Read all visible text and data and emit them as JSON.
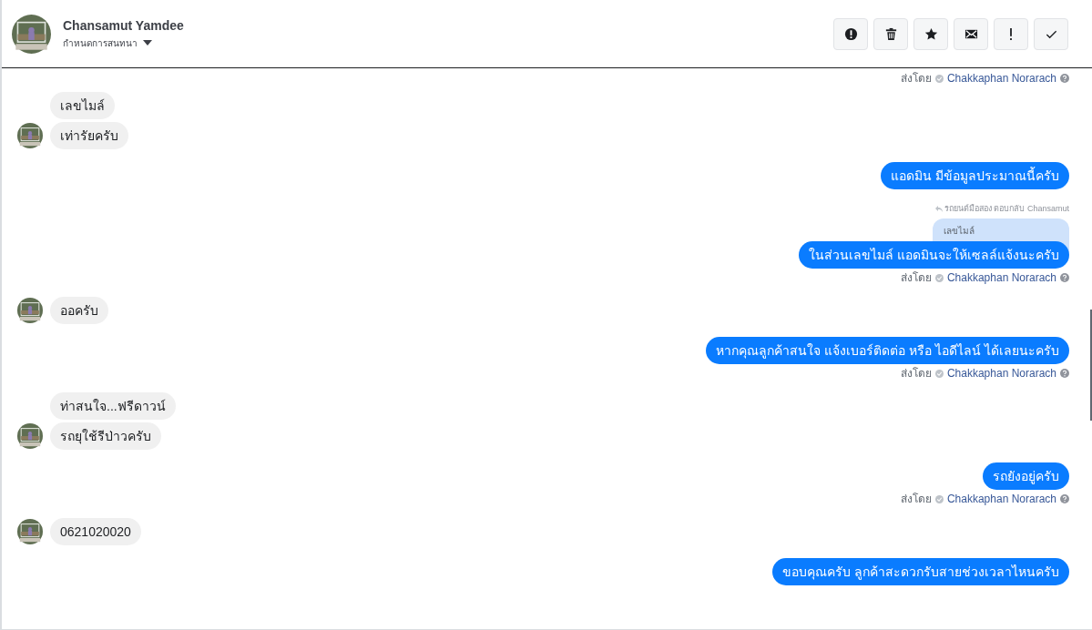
{
  "header": {
    "name": "Chansamut Yamdee",
    "subtitle": "กำหนดการสนทนา",
    "actions": [
      {
        "kind": "alert"
      },
      {
        "kind": "delete"
      },
      {
        "kind": "star"
      },
      {
        "kind": "mail"
      },
      {
        "kind": "important"
      },
      {
        "kind": "done"
      }
    ]
  },
  "messages": [
    {
      "kind": "sent_by",
      "label": "ส่งโดย",
      "sender": "Chakkaphan Norarach"
    },
    {
      "kind": "incoming",
      "bubbles": [
        "เลขไมล์",
        "เท่ารัยครับ"
      ]
    },
    {
      "kind": "outgoing",
      "text": "แอดมิน มีข้อมูลประมาณนี้ครับ"
    },
    {
      "kind": "reply",
      "note": "รถยนต์มือสอง ตอบกลับ Chansamut",
      "quote": "เลขไมล์",
      "text": "ในส่วนเลขไมล์ แอดมินจะให้เซลล์แจ้งนะครับ"
    },
    {
      "kind": "sent_by",
      "label": "ส่งโดย",
      "sender": "Chakkaphan Norarach"
    },
    {
      "kind": "incoming",
      "bubbles": [
        "ออครับ"
      ]
    },
    {
      "kind": "outgoing",
      "text": "หากคุณลูกค้าสนใจ แจ้งเบอร์ติดต่อ หรือ ไอดีไลน์ ได้เลยนะครับ"
    },
    {
      "kind": "sent_by",
      "label": "ส่งโดย",
      "sender": "Chakkaphan Norarach"
    },
    {
      "kind": "incoming",
      "bubbles": [
        "ท่าสนใจ...ฟรีดาวน์",
        "รถยุใช้รีป่าวครับ"
      ]
    },
    {
      "kind": "outgoing",
      "text": "รถยังอยู่ครับ"
    },
    {
      "kind": "sent_by",
      "label": "ส่งโดย",
      "sender": "Chakkaphan Norarach"
    },
    {
      "kind": "incoming",
      "bubbles": [
        "0621020020"
      ]
    },
    {
      "kind": "outgoing",
      "text": "ขอบคุณครับ ลูกค้าสะดวกรับสายช่วงเวลาไหนครับ"
    }
  ]
}
